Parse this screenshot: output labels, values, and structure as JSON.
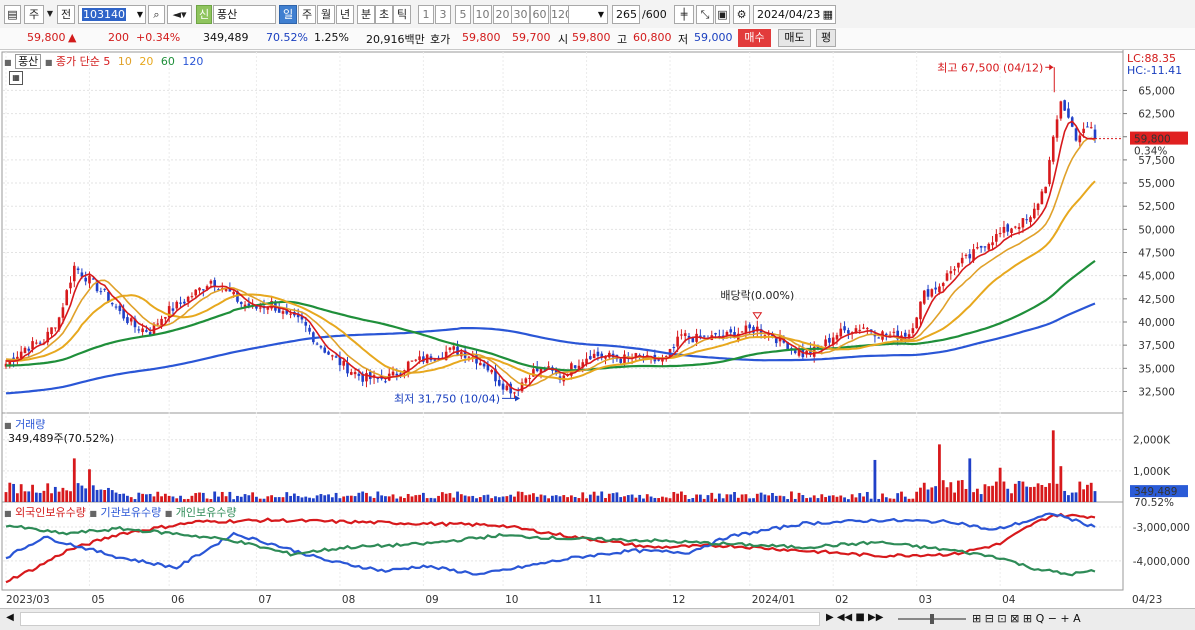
{
  "toolbar": {
    "period_label": "주",
    "prev_label": "전",
    "code": "103140",
    "stock_badge": "신",
    "stock_name": "풍산",
    "intervals": [
      "일",
      "주",
      "월",
      "년",
      "분",
      "초",
      "틱"
    ],
    "minutes": [
      "1",
      "3",
      "5",
      "10",
      "20",
      "30",
      "60",
      "120"
    ],
    "count": "265",
    "count_total": "/600",
    "date": "2024/04/23"
  },
  "quote": {
    "price": "59,800",
    "arrow": "▲",
    "change": "200",
    "change_pct": "+0.34%",
    "volume": "349,489",
    "volume_ratio": "70.52%",
    "turnover": "1.25%",
    "amount": "20,916백만",
    "bid_label": "호가",
    "ask": "59,800",
    "bid": "59,700",
    "open_label": "시",
    "open": "59,800",
    "high_label": "고",
    "high": "60,800",
    "low_label": "저",
    "low": "59,000",
    "buy_label": "매수",
    "sell_label": "매도",
    "eval_label": "평"
  },
  "price_panel": {
    "name": "풍산",
    "ma_label": "종가 단순",
    "ma_periods": [
      "5",
      "10",
      "20",
      "60",
      "120"
    ],
    "lc_label": "LC:88.35",
    "hc_label": "HC:-11.41",
    "current_price": "59,800",
    "current_pct": "0.34%",
    "high_annotation": "최고 67,500 (04/12)",
    "low_annotation": "최저 31,750 (10/04)",
    "dividend_annotation": "배당락(0.00%)"
  },
  "volume_panel": {
    "title": "거래량",
    "subtitle": "349,489주(70.52%)",
    "current": "349,489",
    "current_pct": "70.52%"
  },
  "holding_panel": {
    "series_labels": [
      "외국인보유수량",
      "기관보유수량",
      "개인보유수량"
    ]
  },
  "x_labels": [
    "2023/03",
    "05",
    "06",
    "07",
    "08",
    "09",
    "10",
    "11",
    "12",
    "2024/01",
    "02",
    "03",
    "04"
  ],
  "x_last_label": "04/23",
  "colors": {
    "up": "#d7191c",
    "down": "#2040c8",
    "ma5": "#d7191c",
    "ma10": "#e0a12a",
    "ma20": "#e7a81e",
    "ma60": "#1f8f3a",
    "ma120": "#2a56d6",
    "foreign": "#d7191c",
    "institution": "#2a56d6",
    "individual": "#2e8b57"
  },
  "chart_data": [
    {
      "type": "candlestick",
      "title": "풍산",
      "ylim": [
        30500,
        68500
      ],
      "y_ticks": [
        32500,
        35000,
        37500,
        40000,
        42500,
        45000,
        47500,
        50000,
        52500,
        55000,
        57500,
        60000,
        62500,
        65000
      ],
      "anchors_close": [
        [
          0,
          35500
        ],
        [
          5,
          37200
        ],
        [
          10,
          38000
        ],
        [
          14,
          40500
        ],
        [
          18,
          46000
        ],
        [
          22,
          44500
        ],
        [
          26,
          43000
        ],
        [
          30,
          41000
        ],
        [
          34,
          39500
        ],
        [
          38,
          39000
        ],
        [
          42,
          41000
        ],
        [
          46,
          42000
        ],
        [
          50,
          43200
        ],
        [
          54,
          44500
        ],
        [
          58,
          43500
        ],
        [
          62,
          42000
        ],
        [
          66,
          41500
        ],
        [
          70,
          42000
        ],
        [
          74,
          40500
        ],
        [
          78,
          40000
        ],
        [
          82,
          37800
        ],
        [
          86,
          36200
        ],
        [
          90,
          35000
        ],
        [
          94,
          34000
        ],
        [
          98,
          33800
        ],
        [
          102,
          34200
        ],
        [
          106,
          35500
        ],
        [
          110,
          36000
        ],
        [
          114,
          36500
        ],
        [
          118,
          37000
        ],
        [
          122,
          36500
        ],
        [
          126,
          35500
        ],
        [
          130,
          33500
        ],
        [
          134,
          32500
        ],
        [
          138,
          34500
        ],
        [
          142,
          35000
        ],
        [
          146,
          34000
        ],
        [
          150,
          35500
        ],
        [
          154,
          36500
        ],
        [
          158,
          36300
        ],
        [
          162,
          36000
        ],
        [
          166,
          36200
        ],
        [
          170,
          35800
        ],
        [
          174,
          36000
        ],
        [
          178,
          38500
        ],
        [
          182,
          38200
        ],
        [
          186,
          38300
        ],
        [
          190,
          38500
        ],
        [
          194,
          39000
        ],
        [
          198,
          39300
        ],
        [
          202,
          38500
        ],
        [
          206,
          37500
        ],
        [
          210,
          36500
        ],
        [
          214,
          37000
        ],
        [
          218,
          38500
        ],
        [
          222,
          39200
        ],
        [
          226,
          39500
        ],
        [
          230,
          38800
        ],
        [
          234,
          38500
        ],
        [
          238,
          38800
        ],
        [
          242,
          43000
        ],
        [
          246,
          44000
        ],
        [
          250,
          46000
        ],
        [
          254,
          47000
        ],
        [
          258,
          48500
        ],
        [
          262,
          49500
        ],
        [
          266,
          50500
        ],
        [
          270,
          51000
        ],
        [
          274,
          55000
        ],
        [
          278,
          64000
        ],
        [
          282,
          60000
        ],
        [
          286,
          61000
        ],
        [
          287,
          59800
        ]
      ],
      "ma_final": {
        "5": 59800,
        "10": 59600,
        "20": 55200,
        "60": 46600,
        "120": 42000
      },
      "ma_start": {
        "5": 35800,
        "10": 36000,
        "20": 35800,
        "60": 35300,
        "120": 32300
      },
      "high": {
        "value": 67500,
        "date": "04/12"
      },
      "low": {
        "value": 31750,
        "date": "10/04"
      },
      "current": 59800
    },
    {
      "type": "bar",
      "title": "거래량",
      "ylim": [
        0,
        2600000
      ],
      "y_ticks": [
        1000000,
        2000000
      ],
      "y_tick_labels": [
        "1,000K",
        "2,000K"
      ],
      "spikes": [
        [
          18,
          1400000
        ],
        [
          22,
          1050000
        ],
        [
          229,
          1350000
        ],
        [
          246,
          1850000
        ],
        [
          254,
          1400000
        ],
        [
          262,
          1100000
        ],
        [
          276,
          2300000
        ],
        [
          278,
          1150000
        ]
      ],
      "current": 349489
    },
    {
      "type": "line",
      "title": "보유수량",
      "ylim": [
        -4800000,
        -2500000
      ],
      "y_ticks": [
        -3000000,
        -4000000
      ],
      "y_tick_labels": [
        "-3,000,000",
        "-4,000,000"
      ],
      "series": [
        {
          "name": "외국인보유수량",
          "anchors": [
            [
              0,
              -4600000
            ],
            [
              8,
              -4200000
            ],
            [
              16,
              -3700000
            ],
            [
              30,
              -3200000
            ],
            [
              50,
              -2850000
            ],
            [
              70,
              -2800000
            ],
            [
              90,
              -2850000
            ],
            [
              110,
              -2900000
            ],
            [
              130,
              -2950000
            ],
            [
              150,
              -3300000
            ],
            [
              170,
              -3600000
            ],
            [
              190,
              -3550000
            ],
            [
              210,
              -3700000
            ],
            [
              230,
              -3850000
            ],
            [
              250,
              -3800000
            ],
            [
              262,
              -3500000
            ],
            [
              270,
              -2950000
            ],
            [
              276,
              -2650000
            ],
            [
              287,
              -2700000
            ]
          ]
        },
        {
          "name": "기관보유수량",
          "anchors": [
            [
              0,
              -3900000
            ],
            [
              10,
              -3300000
            ],
            [
              20,
              -3600000
            ],
            [
              30,
              -3900000
            ],
            [
              45,
              -4200000
            ],
            [
              60,
              -3200000
            ],
            [
              70,
              -3500000
            ],
            [
              85,
              -4000000
            ],
            [
              100,
              -4300000
            ],
            [
              110,
              -4150000
            ],
            [
              125,
              -4400000
            ],
            [
              135,
              -4200000
            ],
            [
              150,
              -3900000
            ],
            [
              165,
              -3700000
            ],
            [
              180,
              -3750000
            ],
            [
              190,
              -3300000
            ],
            [
              210,
              -2900000
            ],
            [
              230,
              -2800000
            ],
            [
              250,
              -2850000
            ],
            [
              260,
              -3100000
            ],
            [
              270,
              -2800000
            ],
            [
              276,
              -2600000
            ],
            [
              287,
              -3000000
            ]
          ]
        },
        {
          "name": "개인보유수량",
          "anchors": [
            [
              0,
              -2950000
            ],
            [
              15,
              -3200000
            ],
            [
              30,
              -3050000
            ],
            [
              45,
              -3200000
            ],
            [
              60,
              -3400000
            ],
            [
              75,
              -3800000
            ],
            [
              90,
              -3600000
            ],
            [
              110,
              -3500000
            ],
            [
              130,
              -3250000
            ],
            [
              150,
              -3350000
            ],
            [
              170,
              -3400000
            ],
            [
              190,
              -3500000
            ],
            [
              210,
              -3600000
            ],
            [
              230,
              -3450000
            ],
            [
              250,
              -3700000
            ],
            [
              262,
              -3900000
            ],
            [
              270,
              -4200000
            ],
            [
              280,
              -4400000
            ],
            [
              287,
              -4300000
            ]
          ]
        }
      ]
    }
  ]
}
